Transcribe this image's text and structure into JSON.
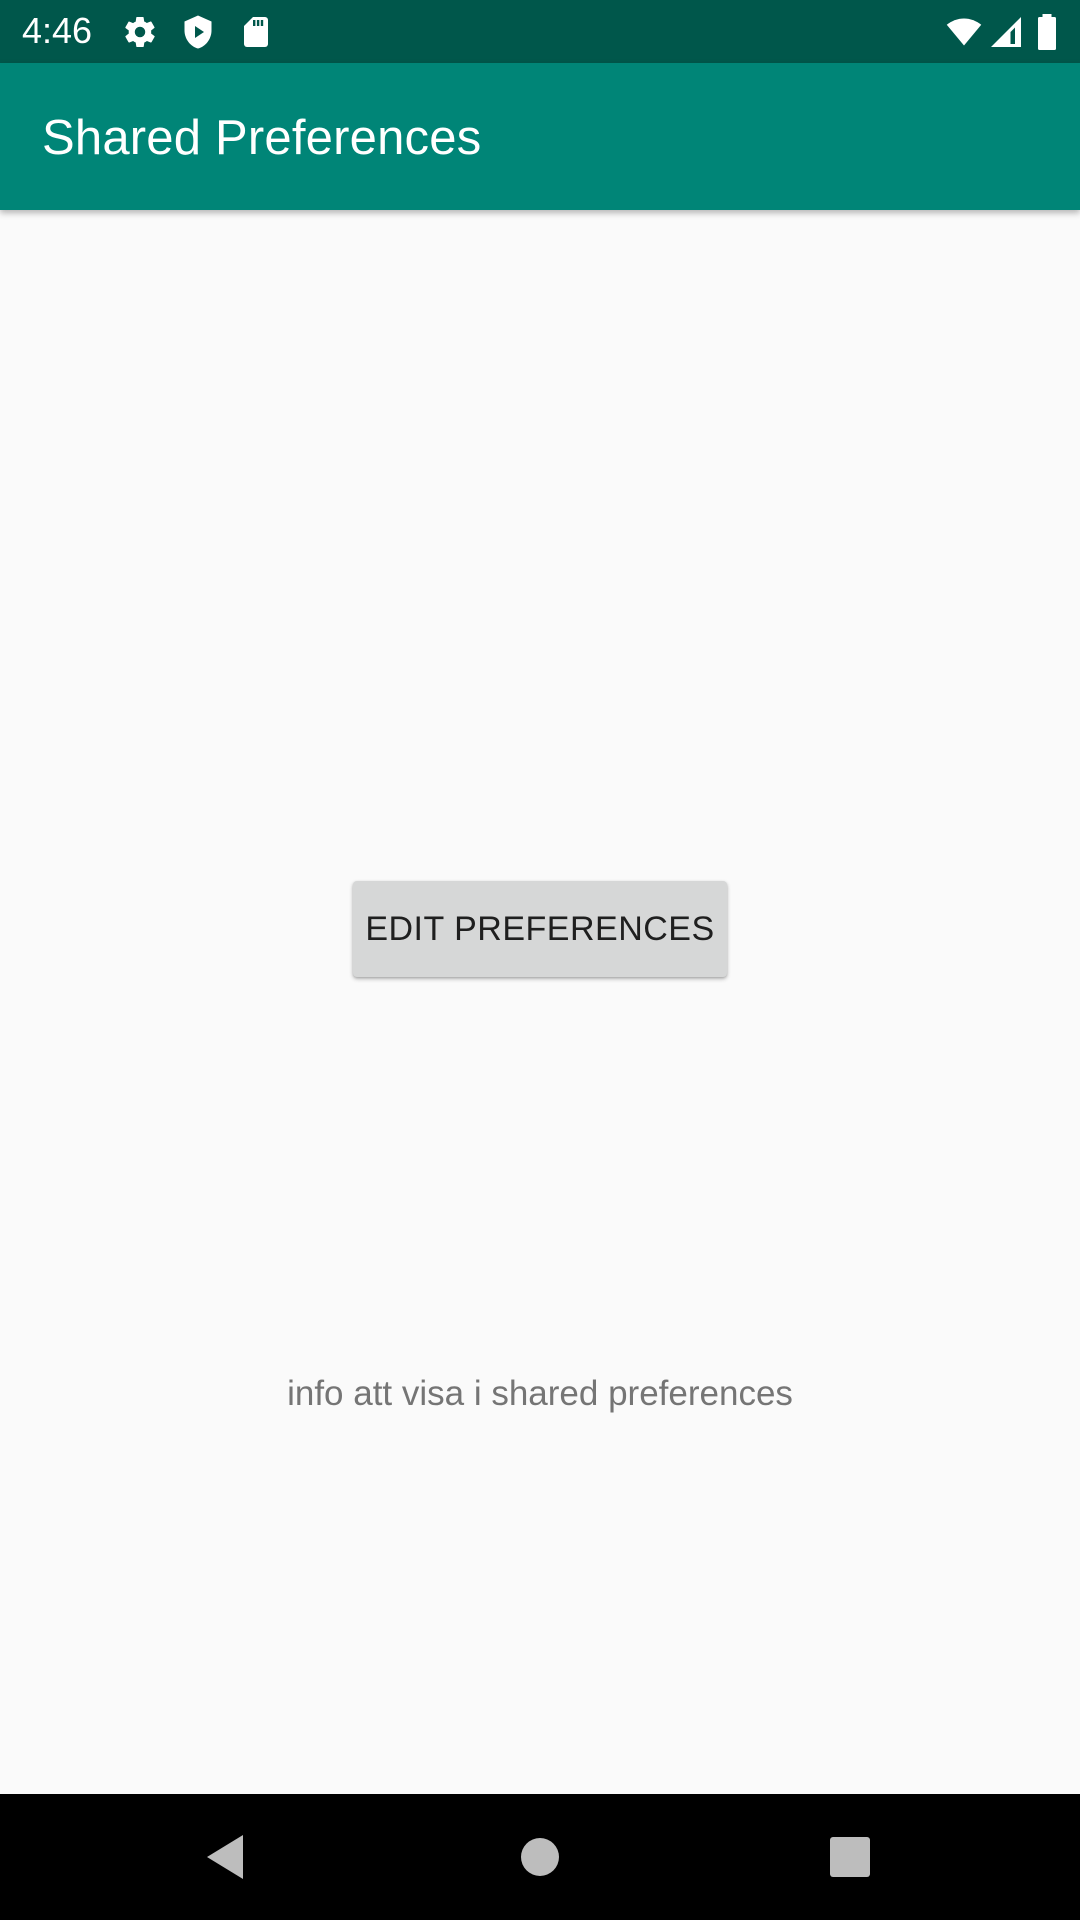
{
  "status_bar": {
    "time": "4:46",
    "icons_left": [
      "gear-icon",
      "shield-play-icon",
      "sd-card-icon"
    ],
    "icons_right": [
      "wifi-icon",
      "cell-signal-icon",
      "battery-icon"
    ],
    "background": "#00574b"
  },
  "app_bar": {
    "title": "Shared Preferences",
    "background": "#008577"
  },
  "main": {
    "edit_button_label": "EDIT PREFERENCES",
    "info_text": "info att visa i shared preferences"
  },
  "nav_bar": {
    "buttons": [
      "back-icon",
      "home-icon",
      "recents-icon"
    ]
  }
}
